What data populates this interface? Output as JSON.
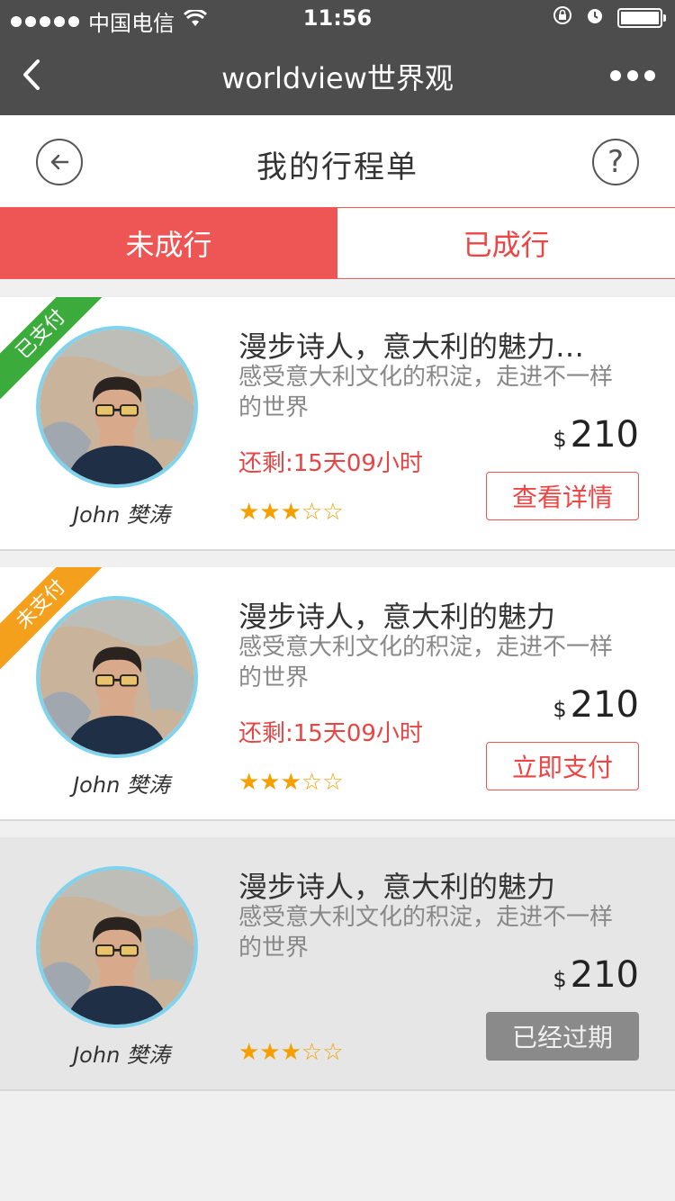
{
  "status_bar": {
    "carrier": "中国电信",
    "time": "11:56"
  },
  "nav": {
    "title": "worldview世界观"
  },
  "header": {
    "title": "我的行程单",
    "help": "?"
  },
  "tabs": [
    {
      "label": "未成行",
      "active": true
    },
    {
      "label": "已成行",
      "active": false
    }
  ],
  "cards": [
    {
      "ribbon": "已支付",
      "guide": "John  樊涛",
      "title": "漫步诗人，意大利的魅力…",
      "desc": "感受意大利文化的积淀，走进不一样的世界",
      "remaining": "还剩:15天09小时",
      "currency": "$",
      "price": "210",
      "rating": "★★★☆☆",
      "button": "查看详情"
    },
    {
      "ribbon": "未支付",
      "guide": "John  樊涛",
      "title": "漫步诗人，意大利的魅力",
      "desc": "感受意大利文化的积淀，走进不一样的世界",
      "remaining": "还剩:15天09小时",
      "currency": "$",
      "price": "210",
      "rating": "★★★☆☆",
      "button": "立即支付"
    },
    {
      "guide": "John  樊涛",
      "title": "漫步诗人，意大利的魅力",
      "desc": "感受意大利文化的积淀，走进不一样的世界",
      "currency": "$",
      "price": "210",
      "rating": "★★★☆☆",
      "button": "已经过期"
    }
  ],
  "colors": {
    "accent": "#ee5555",
    "paid_ribbon": "#3bab3b",
    "unpaid_ribbon": "#f5a01c",
    "star": "#f4a100",
    "avatar_ring": "#7fd3ec"
  }
}
